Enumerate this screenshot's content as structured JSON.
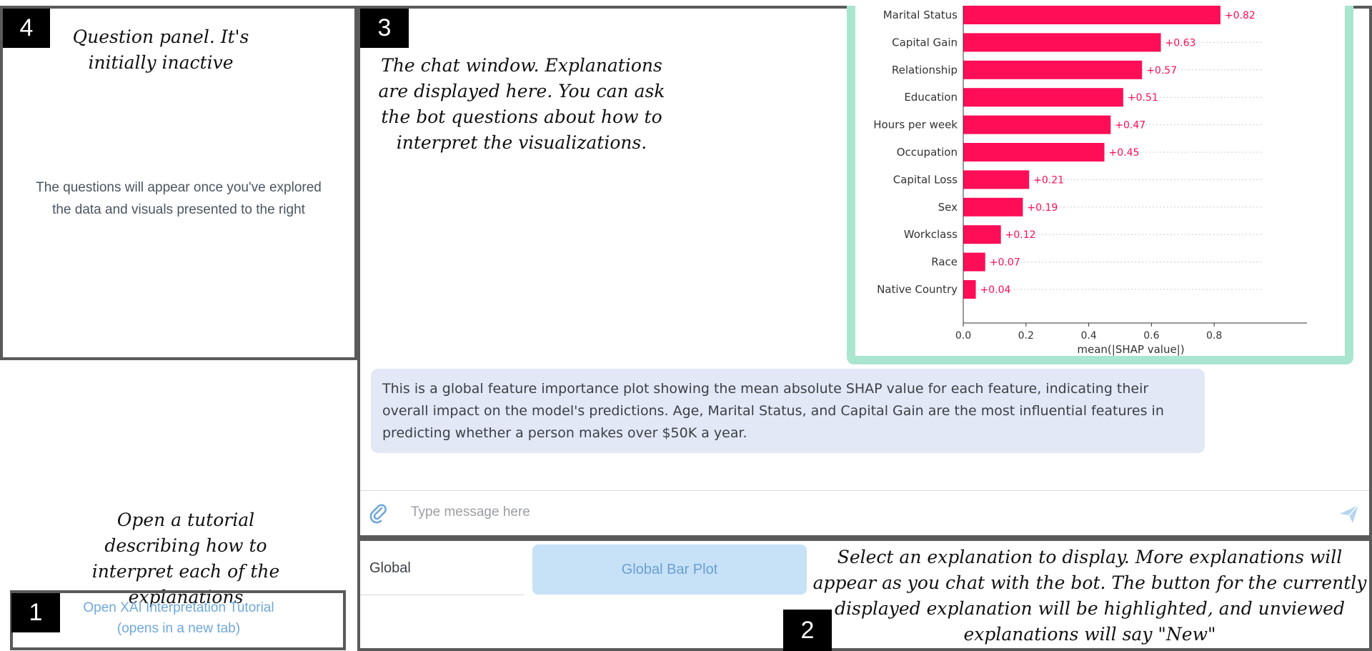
{
  "question_panel": {
    "badge": "4",
    "annotation": "Question panel. It's initially inactive",
    "placeholder_line1": "The questions will appear once you've explored",
    "placeholder_line2": "the data and visuals presented to the right"
  },
  "chat_window": {
    "badge": "3",
    "annotation": "The chat window. Explanations are displayed here. You can ask the bot questions about how to interpret the visualizations.",
    "message": "This is a global feature importance plot showing the mean absolute SHAP value for each feature, indicating their overall impact on the model's predictions. Age, Marital Status, and Capital Gain are the most influential features in predicting whether a person makes over $50K a year.",
    "input_placeholder": "Type message here",
    "attach_icon": "paperclip-icon",
    "send_icon": "send-icon"
  },
  "tutorial": {
    "badge": "1",
    "annotation": "Open a tutorial describing how to interpret each of the explanations",
    "link_line1": "Open XAI Interpretation Tutorial",
    "link_line2": "(opens in a new tab)"
  },
  "explanation_selector": {
    "badge": "2",
    "category_label": "Global",
    "button_label": "Global Bar Plot",
    "annotation": "Select an explanation to display. More explanations will appear as you chat with the bot. The button for the currently displayed explanation will be highlighted, and unviewed explanations will say \"New\""
  },
  "colors": {
    "bar": "#ff0d57",
    "chart_border": "#a9e5cf",
    "message_bg": "#e3e8f7",
    "button_bg": "#c7e2f7"
  },
  "chart_data": {
    "type": "bar",
    "orientation": "horizontal",
    "categories": [
      "Marital Status",
      "Capital Gain",
      "Relationship",
      "Education",
      "Hours per week",
      "Occupation",
      "Capital Loss",
      "Sex",
      "Workclass",
      "Race",
      "Native Country"
    ],
    "values": [
      0.82,
      0.63,
      0.57,
      0.51,
      0.47,
      0.45,
      0.21,
      0.19,
      0.12,
      0.07,
      0.04
    ],
    "value_labels": [
      "+0.82",
      "+0.63",
      "+0.57",
      "+0.51",
      "+0.47",
      "+0.45",
      "+0.21",
      "+0.19",
      "+0.12",
      "+0.07",
      "+0.04"
    ],
    "xlabel": "mean(|SHAP value|)",
    "xticks": [
      "0.0",
      "0.2",
      "0.4",
      "0.6",
      "0.8"
    ],
    "tick_values": [
      0.0,
      0.2,
      0.4,
      0.6,
      0.8
    ],
    "xlim": [
      0,
      0.95
    ],
    "grid": true
  }
}
